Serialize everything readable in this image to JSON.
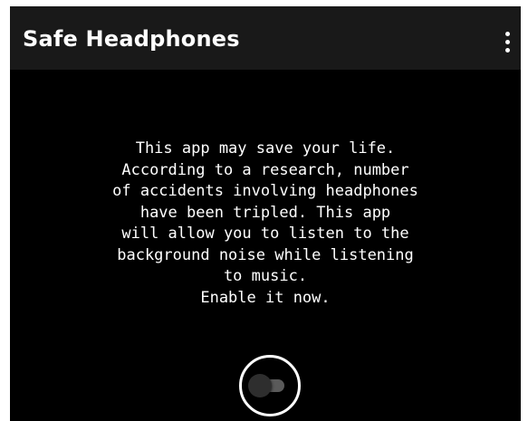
{
  "app_bar": {
    "title": "Safe Headphones",
    "menu_icon": "more-vert-icon"
  },
  "main": {
    "message": "This app may save your life.\nAccording to a research, number\nof accidents involving headphones\nhave been tripled. This app\nwill allow you to listen to the\nbackground noise while listening\nto music.\nEnable it now."
  },
  "toggle": {
    "state": "off"
  },
  "colors": {
    "background": "#000000",
    "app_bar": "#191919",
    "text": "#ffffff",
    "switch_track": "#5a5a5a",
    "switch_thumb": "#2e2e2e"
  }
}
